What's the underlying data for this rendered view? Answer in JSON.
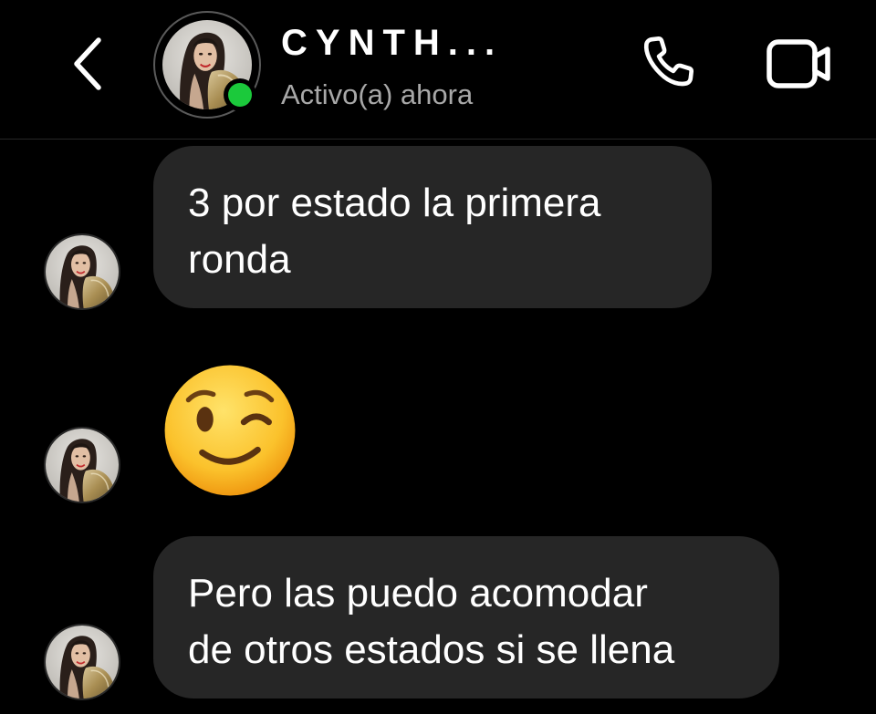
{
  "header": {
    "contact_name": "CYNTH...",
    "status": "Activo(a) ahora",
    "back_icon": "chevron-left-icon",
    "call_icon": "phone-icon",
    "video_icon": "video-camera-icon",
    "online_color": "#1bc93b"
  },
  "messages": [
    {
      "type": "text",
      "lines": [
        "3 por estado la primera",
        "ronda"
      ]
    },
    {
      "type": "emoji",
      "emoji": "winking-face"
    },
    {
      "type": "text",
      "lines": [
        "Pero las puedo acomodar",
        "de otros estados si se llena"
      ]
    }
  ],
  "colors": {
    "background": "#000000",
    "bubble": "#262626",
    "text": "#ffffff",
    "secondary_text": "#a8a8a8"
  }
}
